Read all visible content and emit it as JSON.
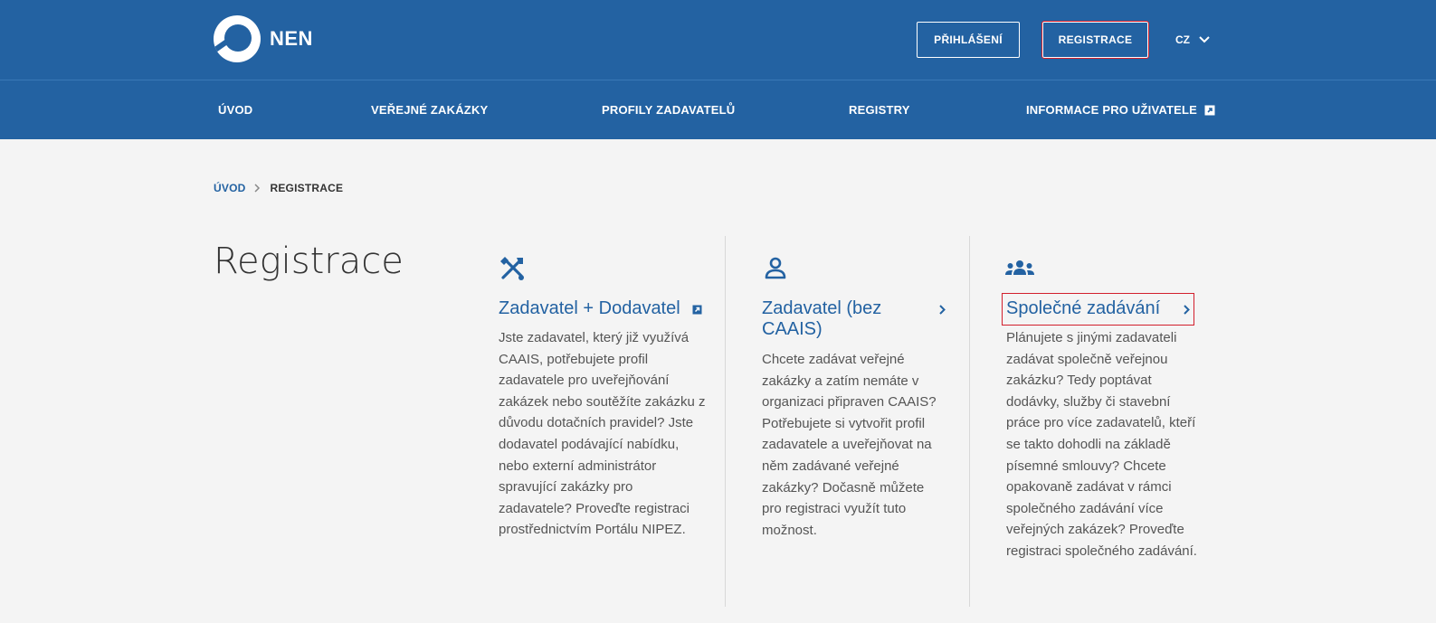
{
  "header": {
    "logo_text": "NEN",
    "login_label": "PŘIHLÁŠENÍ",
    "register_label": "REGISTRACE",
    "language": "CZ"
  },
  "nav": {
    "items": [
      {
        "label": "ÚVOD"
      },
      {
        "label": "VEŘEJNÉ ZAKÁZKY"
      },
      {
        "label": "PROFILY ZADAVATELŮ"
      },
      {
        "label": "REGISTRY"
      },
      {
        "label": "INFORMACE PRO UŽIVATELE"
      }
    ]
  },
  "breadcrumb": {
    "home": "ÚVOD",
    "current": "REGISTRACE"
  },
  "page": {
    "title": "Registrace"
  },
  "cards": [
    {
      "icon": "tools-icon",
      "title": "Zadavatel + Dodavatel",
      "link_icon": "external-link-icon",
      "text": "Jste zadavatel, který již využívá CAAIS, potřebujete profil zadavatele pro uveřejňování zakázek nebo soutěžíte zakázku z důvodu dotačních pravidel? Jste dodavatel podávající nabídku, nebo externí administrátor spravující zakázky pro zadavatele? Proveďte registraci prostřednictvím Portálu NIPEZ."
    },
    {
      "icon": "person-icon",
      "title": "Zadavatel (bez CAAIS)",
      "link_icon": "chevron-right-icon",
      "text": "Chcete zadávat veřejné zakázky a zatím nemáte v organizaci připraven CAAIS? Potřebujete si vytvořit profil zadavatele a uveřejňovat na něm zadávané veřejné zakázky? Dočasně můžete pro registraci využít tuto možnost."
    },
    {
      "icon": "group-icon",
      "title": "Společné zadávání",
      "link_icon": "chevron-right-icon",
      "text": "Plánujete s jinými zadavateli zadávat společně veřejnou zakázku? Tedy poptávat dodávky, služby či stavební práce pro více zadavatelů, kteří se takto dohodli na základě písemné smlouvy? Chcete opakovaně zadávat v rámci společného zadávání více veřejných zakázek? Proveďte registraci společného zadávání."
    }
  ],
  "colors": {
    "brand_blue": "#2362a2",
    "focus_red": "#d21f2c",
    "background": "#f4f4f4"
  }
}
